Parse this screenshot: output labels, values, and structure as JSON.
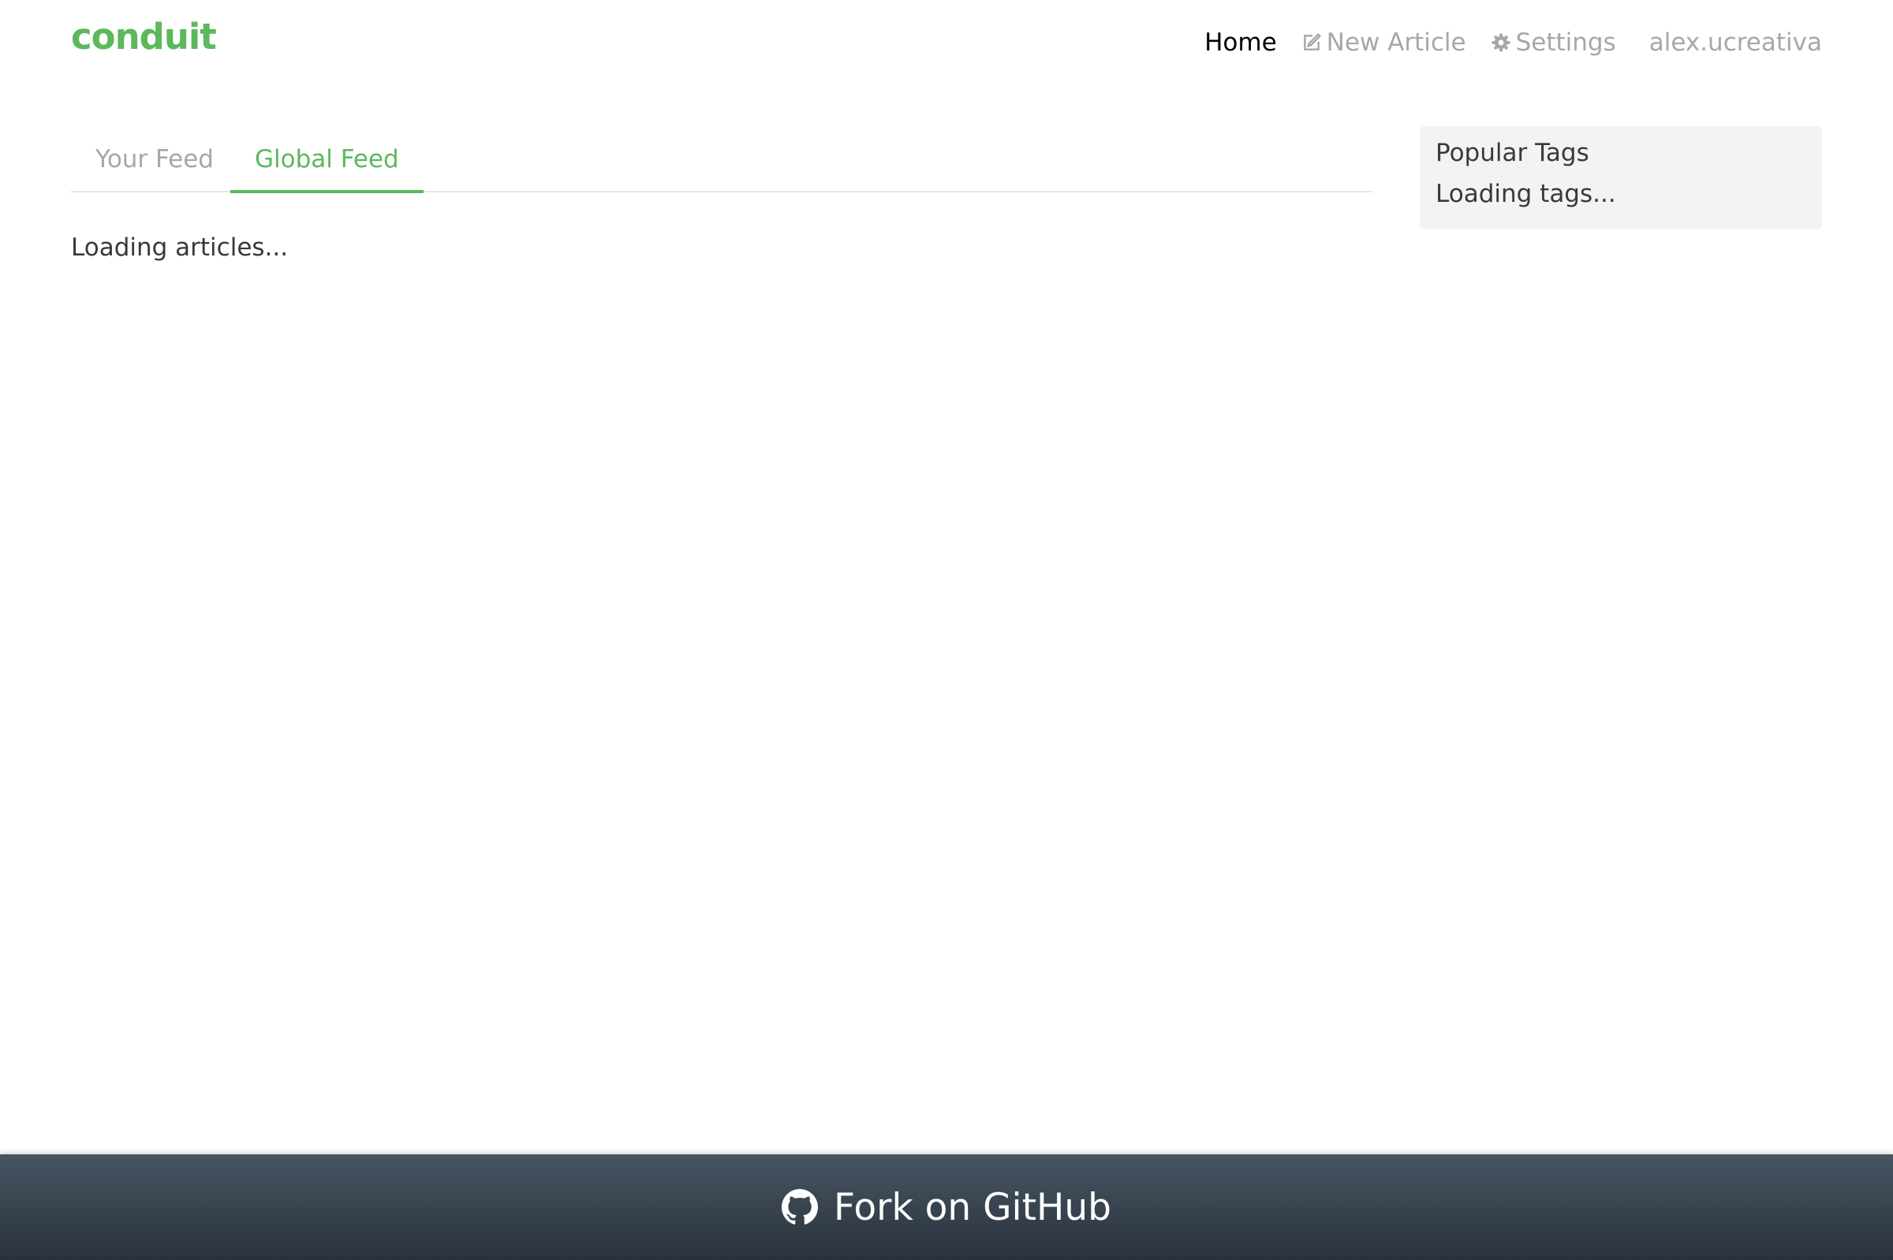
{
  "colors": {
    "brand": "#5cb85c",
    "nav_active": "#000000",
    "nav_inactive": "#a7a7a7",
    "tab_inactive": "#a7a7a7",
    "tab_active": "#5cb85c",
    "text": "#373a3c",
    "sidebar_bg": "#f3f3f3"
  },
  "navbar": {
    "brand": "conduit",
    "links": {
      "home": "Home",
      "new_article": "New Article",
      "settings": "Settings",
      "profile": "alex.ucreativa"
    },
    "icons": {
      "new_article": "edit-icon",
      "settings": "gear-icon"
    }
  },
  "feed": {
    "tabs": [
      {
        "label": "Your Feed",
        "active": false
      },
      {
        "label": "Global Feed",
        "active": true
      }
    ],
    "loading_text": "Loading articles..."
  },
  "sidebar": {
    "title": "Popular Tags",
    "loading_text": "Loading tags..."
  },
  "footer": {
    "label": "Fork on GitHub",
    "icon": "github-icon"
  }
}
